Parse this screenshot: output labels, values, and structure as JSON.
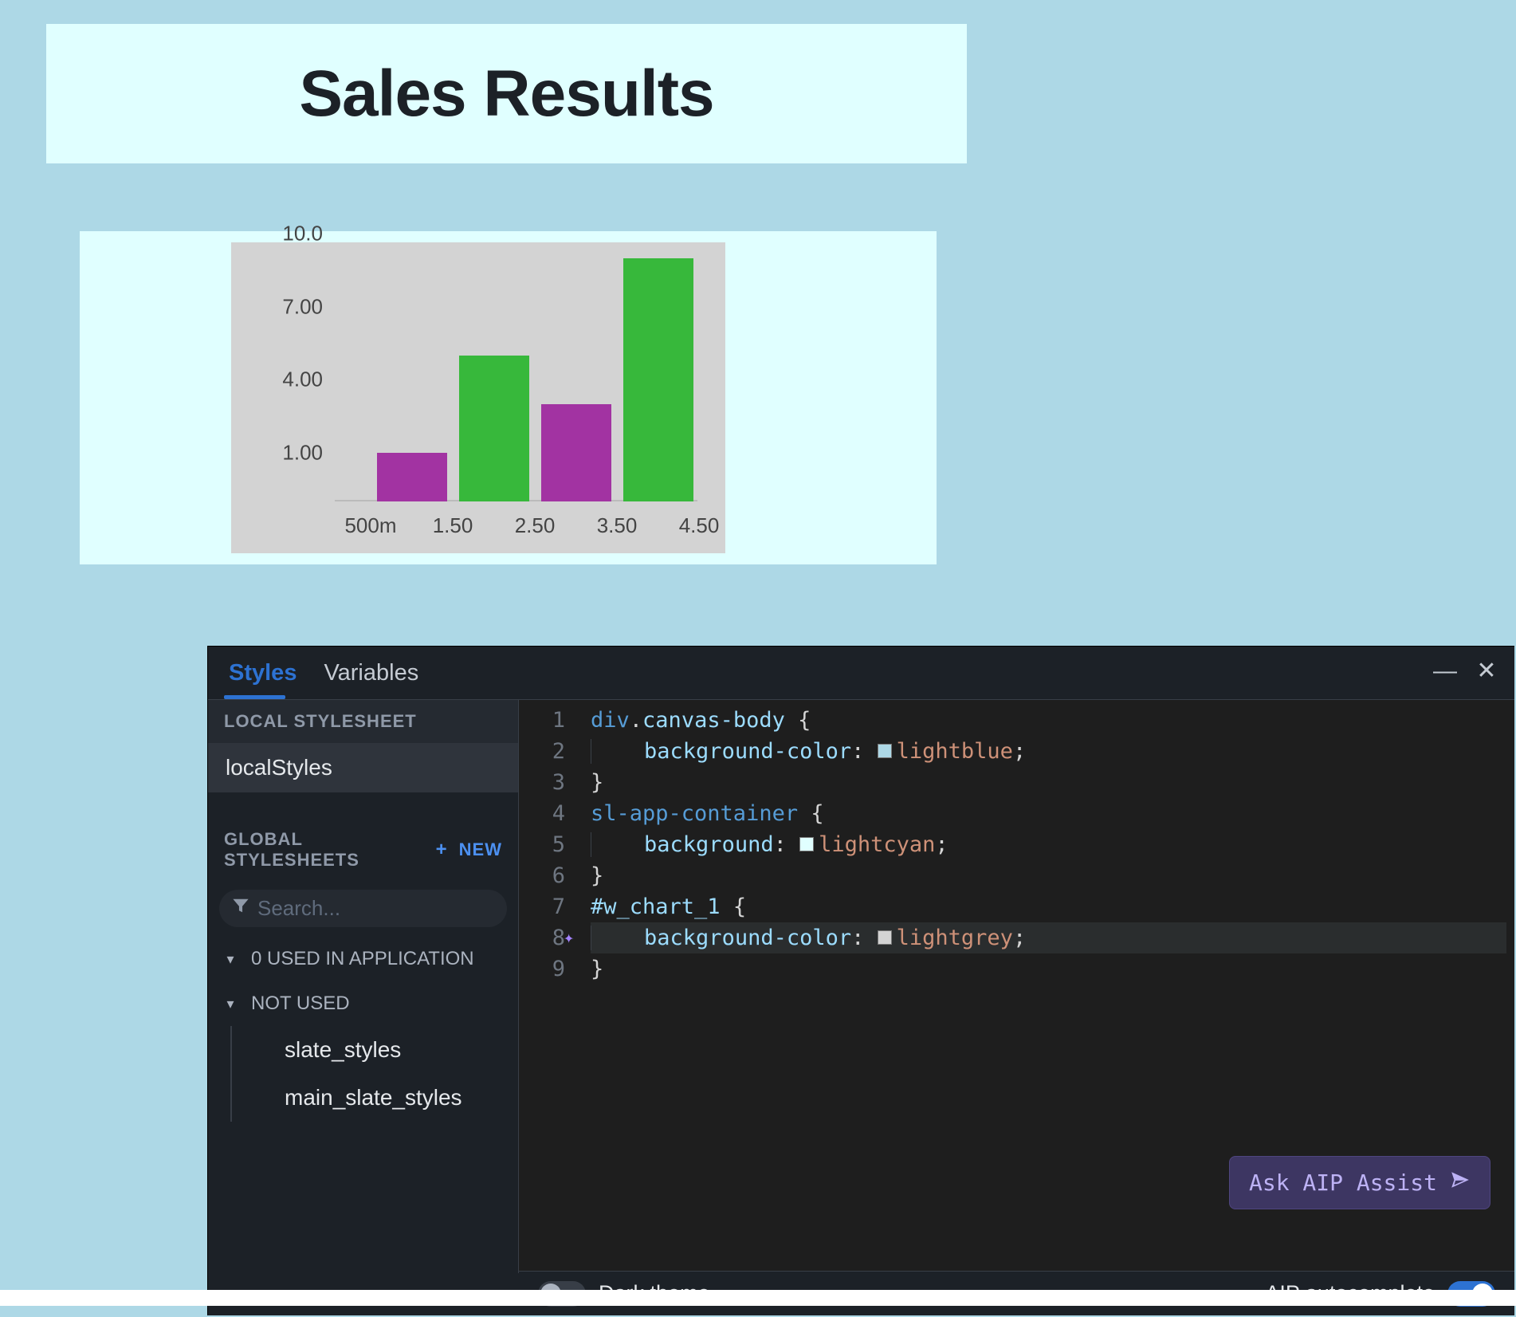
{
  "report": {
    "title": "Sales Results"
  },
  "chart_data": {
    "type": "bar",
    "title": "",
    "xlabel": "",
    "ylabel": "",
    "ylim": [
      0,
      10
    ],
    "y_ticks": [
      "10.0",
      "7.00",
      "4.00",
      "1.00"
    ],
    "x_ticks": [
      "500m",
      "1.50",
      "2.50",
      "3.50",
      "4.50"
    ],
    "series": [
      {
        "x": 1,
        "value": 2,
        "color": "#a233a2"
      },
      {
        "x": 2,
        "value": 6,
        "color": "#37b83b"
      },
      {
        "x": 3,
        "value": 4,
        "color": "#a233a2"
      },
      {
        "x": 4,
        "value": 10,
        "color": "#37b83b"
      }
    ]
  },
  "panel": {
    "tabs": {
      "styles": "Styles",
      "variables": "Variables"
    },
    "window": {
      "minimize": "—",
      "close": "✕"
    },
    "sidebar": {
      "local_hdr": "LOCAL STYLESHEET",
      "local_item": "localStyles",
      "global_hdr": "GLOBAL STYLESHEETS",
      "new_label": "NEW",
      "search_placeholder": "Search...",
      "used_label": "0 USED IN APPLICATION",
      "not_used_label": "NOT USED",
      "not_used_items": [
        "slate_styles",
        "main_slate_styles"
      ]
    },
    "editor": {
      "lines": [
        {
          "n": 1,
          "segments": [
            {
              "t": "div",
              "c": "tok-tag"
            },
            {
              "t": ".",
              "c": "tok-punct"
            },
            {
              "t": "canvas-body",
              "c": "tok-sel"
            },
            {
              "t": " {",
              "c": "tok-punct"
            }
          ]
        },
        {
          "n": 2,
          "indent": 1,
          "segments": [
            {
              "t": "background-color",
              "c": "tok-prop"
            },
            {
              "t": ": ",
              "c": "tok-punct"
            },
            {
              "swatch": "#add8e6"
            },
            {
              "t": "lightblue",
              "c": "tok-val"
            },
            {
              "t": ";",
              "c": "tok-punct"
            }
          ]
        },
        {
          "n": 3,
          "segments": [
            {
              "t": "}",
              "c": "tok-punct"
            }
          ]
        },
        {
          "n": 4,
          "segments": [
            {
              "t": "sl-app-container",
              "c": "tok-tag"
            },
            {
              "t": " {",
              "c": "tok-punct"
            }
          ]
        },
        {
          "n": 5,
          "indent": 1,
          "segments": [
            {
              "t": "background",
              "c": "tok-prop"
            },
            {
              "t": ": ",
              "c": "tok-punct"
            },
            {
              "swatch": "#e0ffff"
            },
            {
              "t": "lightcyan",
              "c": "tok-val"
            },
            {
              "t": ";",
              "c": "tok-punct"
            }
          ]
        },
        {
          "n": 6,
          "segments": [
            {
              "t": "}",
              "c": "tok-punct"
            }
          ]
        },
        {
          "n": 7,
          "segments": [
            {
              "t": "#w_chart_1",
              "c": "tok-id"
            },
            {
              "t": " {",
              "c": "tok-punct"
            }
          ]
        },
        {
          "n": 8,
          "indent": 1,
          "cursor": true,
          "ai": true,
          "segments": [
            {
              "t": "background-color",
              "c": "tok-prop"
            },
            {
              "t": ": ",
              "c": "tok-punct"
            },
            {
              "swatch": "#d3d3d3"
            },
            {
              "t": "lightgrey",
              "c": "tok-val"
            },
            {
              "t": ";",
              "c": "tok-punct"
            }
          ]
        },
        {
          "n": 9,
          "segments": [
            {
              "t": "}",
              "c": "tok-punct"
            }
          ]
        }
      ]
    },
    "ask_button": "Ask AIP Assist",
    "footer": {
      "dark_theme": "Dark theme",
      "autocomplete": "AIP autocomplete"
    }
  }
}
